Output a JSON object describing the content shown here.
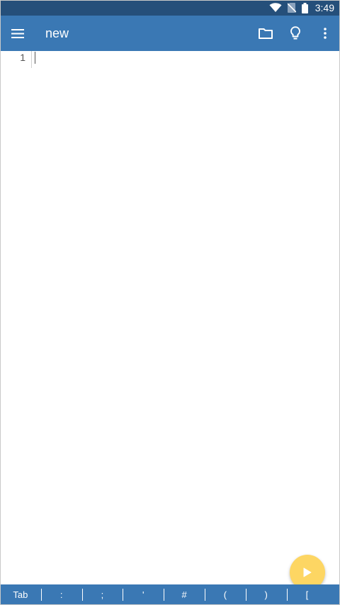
{
  "status_bar": {
    "time": "3:49",
    "icons": [
      "wifi-icon",
      "no-sim-icon",
      "battery-icon"
    ]
  },
  "app_bar": {
    "title": "new",
    "menu_icon": "menu-icon",
    "actions": [
      "folder-icon",
      "lightbulb-icon",
      "more-vert-icon"
    ]
  },
  "editor": {
    "line_numbers": [
      "1"
    ],
    "content": ""
  },
  "fab": {
    "icon": "play-icon"
  },
  "key_bar": {
    "keys": [
      "Tab",
      ":",
      ";",
      "'",
      "#",
      "(",
      ")",
      "["
    ]
  },
  "colors": {
    "status_bar": "#254f7a",
    "app_bar": "#3a78b4",
    "fab": "#fdd663"
  }
}
